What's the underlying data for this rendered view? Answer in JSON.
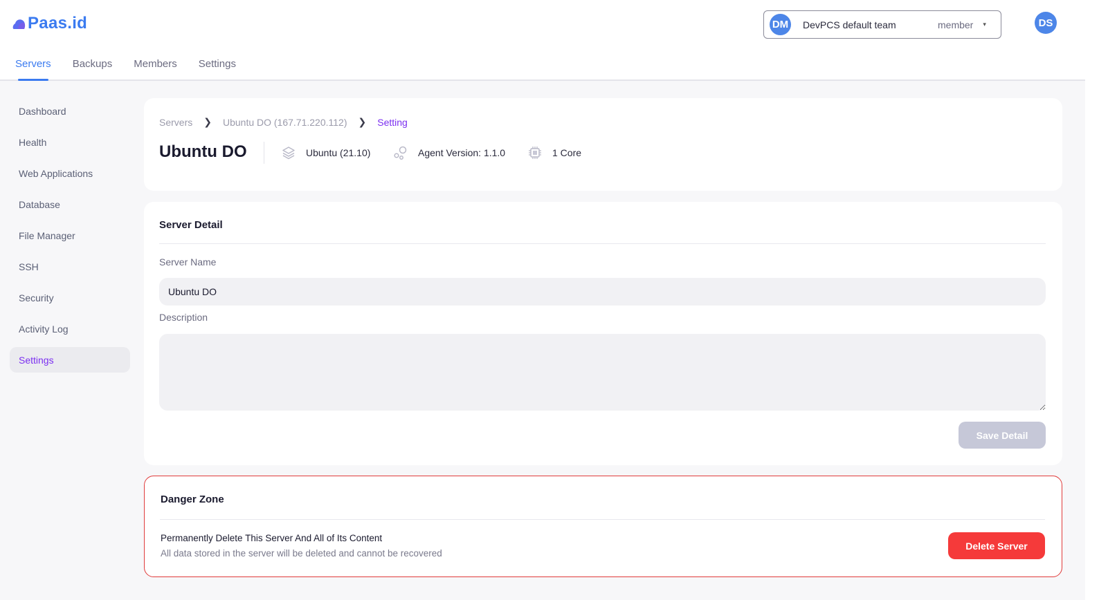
{
  "brand": {
    "name": "Paas.id",
    "color": "#3b7bf0"
  },
  "top_tabs": [
    {
      "label": "Servers",
      "active": true
    },
    {
      "label": "Backups",
      "active": false
    },
    {
      "label": "Members",
      "active": false
    },
    {
      "label": "Settings",
      "active": false
    }
  ],
  "team_selector": {
    "initials": "DM",
    "team_name": "DevPCS default team",
    "role": "member",
    "caret": "⌄"
  },
  "user": {
    "initials": "DS"
  },
  "sidebar": {
    "items": [
      {
        "label": "Dashboard",
        "active": false
      },
      {
        "label": "Health",
        "active": false
      },
      {
        "label": "Web Applications",
        "active": false
      },
      {
        "label": "Database",
        "active": false
      },
      {
        "label": "File Manager",
        "active": false
      },
      {
        "label": "SSH",
        "active": false
      },
      {
        "label": "Security",
        "active": false
      },
      {
        "label": "Activity Log",
        "active": false
      },
      {
        "label": "Settings",
        "active": true
      }
    ]
  },
  "breadcrumb": {
    "items": [
      "Servers",
      "Ubuntu DO (167.71.220.112)",
      "Setting"
    ],
    "separator": "›"
  },
  "server": {
    "title": "Ubuntu DO",
    "os": "Ubuntu (21.10)",
    "agent_version": "Agent Version: 1.1.0",
    "cores": "1 Core"
  },
  "server_detail": {
    "title": "Server Detail",
    "name_label": "Server Name",
    "name_value": "Ubuntu DO",
    "description_label": "Description",
    "description_value": "",
    "save_label": "Save Detail"
  },
  "danger_zone": {
    "title": "Danger Zone",
    "heading": "Permanently Delete This Server And All of Its Content",
    "subtext": "All data stored in the server will be deleted and cannot be recovered",
    "delete_label": "Delete Server",
    "accent": "#f53a3a"
  }
}
